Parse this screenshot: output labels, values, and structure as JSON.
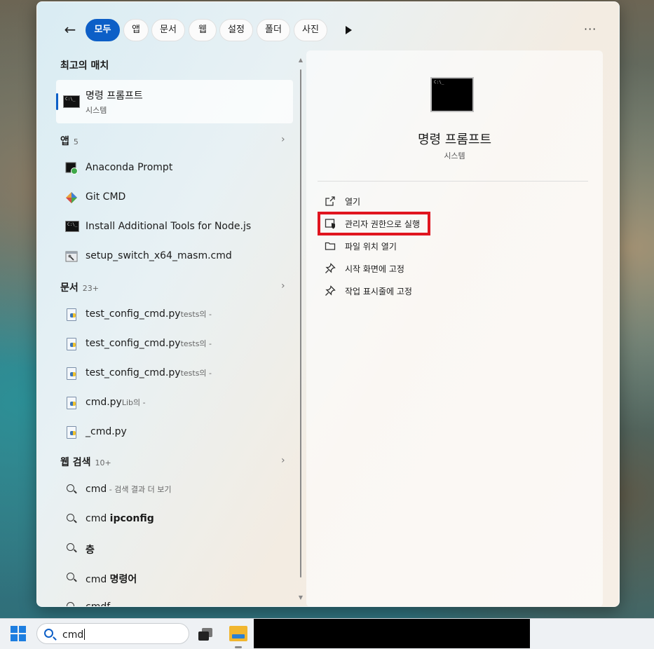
{
  "filters": {
    "back_icon": "back-arrow-icon",
    "chips": [
      {
        "label": "모두",
        "active": true
      },
      {
        "label": "앱",
        "active": false
      },
      {
        "label": "문서",
        "active": false
      },
      {
        "label": "웹",
        "active": false
      },
      {
        "label": "설정",
        "active": false
      },
      {
        "label": "폴더",
        "active": false
      },
      {
        "label": "사진",
        "active": false
      }
    ],
    "more_label": "···"
  },
  "best_match": {
    "heading": "최고의 매치",
    "title": "명령 프롬프트",
    "subtitle": "시스템"
  },
  "apps": {
    "heading": "앱",
    "count": "5",
    "items": [
      {
        "label": "Anaconda Prompt",
        "icon": "anaconda-prompt-icon"
      },
      {
        "label": "Git CMD",
        "icon": "git-icon"
      },
      {
        "label": "Install Additional Tools for Node.js",
        "icon": "cmd-icon"
      },
      {
        "label": "setup_switch_x64_masm.cmd",
        "icon": "cmd-script-icon"
      }
    ]
  },
  "documents": {
    "heading": "문서",
    "count": "23+",
    "items": [
      {
        "label": "test_config_cmd.py",
        "suffix": "tests의 -"
      },
      {
        "label": "test_config_cmd.py",
        "suffix": "tests의 -"
      },
      {
        "label": "test_config_cmd.py",
        "suffix": "tests의 -"
      },
      {
        "label": "cmd.py",
        "suffix": "Lib의 -"
      },
      {
        "label": "_cmd.py",
        "suffix": ""
      }
    ]
  },
  "web": {
    "heading": "웹 검색",
    "count": "10+",
    "items": [
      {
        "prefix": "cmd",
        "bold": "",
        "suffix": " - 검색 결과 더 보기"
      },
      {
        "prefix": "cmd ",
        "bold": "ipconfig",
        "suffix": ""
      },
      {
        "prefix": "",
        "bold": "층",
        "suffix": ""
      },
      {
        "prefix": "cmd ",
        "bold": "명령어",
        "suffix": ""
      },
      {
        "prefix": "cmdf",
        "bold": "",
        "suffix": ""
      }
    ]
  },
  "detail": {
    "title": "명령 프롬프트",
    "subtitle": "시스템",
    "actions": [
      {
        "label": "열기",
        "icon": "open-external-icon"
      },
      {
        "label": "관리자 권한으로 실행",
        "icon": "admin-shield-icon"
      },
      {
        "label": "파일 위치 열기",
        "icon": "folder-icon"
      },
      {
        "label": "시작 화면에 고정",
        "icon": "pin-icon"
      },
      {
        "label": "작업 표시줄에 고정",
        "icon": "pin-icon"
      }
    ]
  },
  "taskbar": {
    "search_query": "cmd"
  },
  "colors": {
    "accent": "#0d5fc7",
    "highlight_box": "#e0151f"
  }
}
